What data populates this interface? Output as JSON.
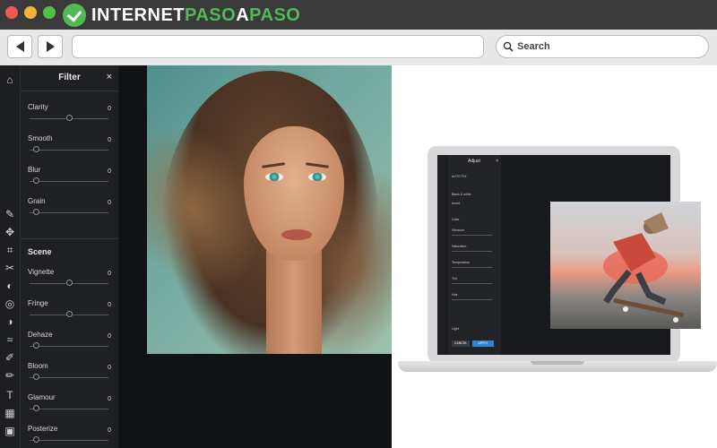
{
  "logo": {
    "part1": "INTERNET",
    "part2": "PASO",
    "part3": "A",
    "part4": "PASO"
  },
  "browser": {
    "url": "",
    "search_placeholder": "Search"
  },
  "editor": {
    "panel_title": "Filter",
    "close_symbol": "×",
    "filters": [
      {
        "label": "Clarity",
        "value": "0"
      },
      {
        "label": "Smooth",
        "value": "0"
      },
      {
        "label": "Blur",
        "value": "0"
      },
      {
        "label": "Grain",
        "value": "0"
      }
    ],
    "scene_title": "Scene",
    "scene_filters": [
      {
        "label": "Vignette",
        "value": "0"
      },
      {
        "label": "Fringe",
        "value": "0"
      },
      {
        "label": "Dehaze",
        "value": "0"
      },
      {
        "label": "Bloom",
        "value": "0"
      },
      {
        "label": "Glamour",
        "value": "0"
      },
      {
        "label": "Posterize",
        "value": "0"
      }
    ]
  },
  "laptop_screen": {
    "panel_title": "Adjust",
    "auto_fix": "AUTO FIX",
    "items": [
      "Black & white",
      "Invert",
      "Color",
      "Vibrance",
      "Saturation",
      "Temperature",
      "Tint",
      "Hue"
    ],
    "light_label": "Light",
    "cancel": "CANCEL",
    "apply": "APPLY"
  },
  "colors": {
    "accent_green": "#53b957",
    "titlebar": "#3a3a3a",
    "editor_bg": "#16171b",
    "panel_bg": "#1f2024"
  }
}
